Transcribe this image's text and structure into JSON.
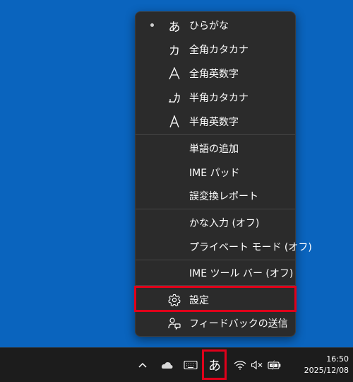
{
  "menu": {
    "input_modes": [
      {
        "icon": "あ",
        "icon_name": "hiragana-icon",
        "label": "ひらがな",
        "selected": true
      },
      {
        "icon": "カ",
        "icon_name": "katakana-icon",
        "label": "全角カタカナ",
        "selected": false
      },
      {
        "icon": "A",
        "icon_name": "fullwidth-alpha-icon",
        "label": "全角英数字",
        "selected": false
      },
      {
        "icon": "ｶ",
        "icon_name": "halfwidth-katakana-icon",
        "label": "半角カタカナ",
        "selected": false
      },
      {
        "icon": "A",
        "icon_name": "halfwidth-alpha-icon",
        "label": "半角英数字",
        "selected": false
      }
    ],
    "tools": [
      {
        "label": "単語の追加"
      },
      {
        "label": "IME パッド"
      },
      {
        "label": "誤変換レポート"
      }
    ],
    "toggles": [
      {
        "label": "かな入力 (オフ)"
      },
      {
        "label": "プライベート モード (オフ)"
      }
    ],
    "toolbar_toggle": {
      "label": "IME ツール バー (オフ)"
    },
    "settings": {
      "label": "設定",
      "icon_name": "gear-icon"
    },
    "feedback": {
      "label": "フィードバックの送信",
      "icon_name": "feedback-icon"
    }
  },
  "taskbar": {
    "ime_indicator": "あ",
    "clock": {
      "time": "16:50",
      "date": "2025/12/08"
    }
  },
  "colors": {
    "desktop": "#0a64be",
    "menu_bg": "#2b2b2b",
    "taskbar_bg": "#1c1c1c",
    "highlight": "#e0001a"
  }
}
